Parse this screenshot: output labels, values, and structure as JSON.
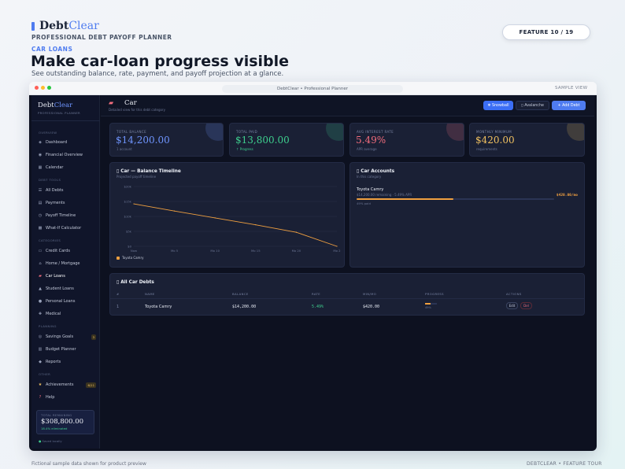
{
  "brand": {
    "name_part1": "Debt",
    "name_part2": "Clear",
    "tagline": "PROFESSIONAL DEBT PAYOFF PLANNER"
  },
  "badge": "FEATURE 10 / 19",
  "eyebrow": "CAR LOANS",
  "headline": "Make car-loan progress visible",
  "subhead": "See outstanding balance, rate, payment, and payoff projection at a glance.",
  "footer": {
    "left": "Fictional sample data shown for product preview",
    "right": "DEBTCLEAR  •  FEATURE TOUR"
  },
  "window": {
    "url": "DebtClear  •  Professional Planner",
    "sample": "SAMPLE VIEW"
  },
  "sidebar": {
    "logo_part1": "Debt",
    "logo_part2": "Clear",
    "subtitle": "PROFESSIONAL PLANNER",
    "sections": {
      "overview": "OVERVIEW",
      "tools": "DEBT TOOLS",
      "categories": "CATEGORIES",
      "planning": "PLANNING",
      "other": "OTHER"
    },
    "items": [
      {
        "label": "Dashboard",
        "icon": "◈"
      },
      {
        "label": "Financial Overview",
        "icon": "◉"
      },
      {
        "label": "Calendar",
        "icon": "▦"
      },
      {
        "label": "All Debts",
        "icon": "☰"
      },
      {
        "label": "Payments",
        "icon": "▤"
      },
      {
        "label": "Payoff Timeline",
        "icon": "◷"
      },
      {
        "label": "What-If Calculator",
        "icon": "▩"
      },
      {
        "label": "Credit Cards",
        "icon": "▭"
      },
      {
        "label": "Home / Mortgage",
        "icon": "⌂"
      },
      {
        "label": "Car Loans",
        "icon": "▰"
      },
      {
        "label": "Student Loans",
        "icon": "▲"
      },
      {
        "label": "Personal Loans",
        "icon": "●"
      },
      {
        "label": "Medical",
        "icon": "✚"
      },
      {
        "label": "Savings Goals",
        "icon": "◎",
        "badge": "3"
      },
      {
        "label": "Budget Planner",
        "icon": "▥"
      },
      {
        "label": "Reports",
        "icon": "◆"
      },
      {
        "label": "Achievements",
        "icon": "★",
        "badge": "6/11"
      },
      {
        "label": "Help",
        "icon": "?"
      }
    ],
    "total_label": "TOTAL REMAINING",
    "total_value": "$308,800.00",
    "total_pct": "18.4% eliminated",
    "saved": "Saved locally"
  },
  "topbar": {
    "title": "Car",
    "subtitle": "Detailed view for this debt category",
    "snowball": "❄ Snowball",
    "avalanche": "▯ Avalanche",
    "add": "+ Add Debt"
  },
  "stats": [
    {
      "label": "TOTAL BALANCE",
      "value": "$14,200.00",
      "sub": "1 account",
      "color": "#6f95ff"
    },
    {
      "label": "TOTAL PAID",
      "value": "$13,800.00",
      "sub": "↑ Progress",
      "color": "#3ecf8e"
    },
    {
      "label": "AVG INTEREST RATE",
      "value": "5.49%",
      "sub": "APR average",
      "color": "#f26d7d"
    },
    {
      "label": "MONTHLY MINIMUM",
      "value": "$420.00",
      "sub": "requirements",
      "color": "#f0c060"
    }
  ],
  "timeline": {
    "title": "▯ Car — Balance Timeline",
    "subtitle": "Projected payoff timeline",
    "legend": "Toyota Camry"
  },
  "chart_data": {
    "type": "line",
    "title": "Car — Balance Timeline",
    "x": [
      "Now",
      "Mo 5",
      "Mo 10",
      "Mo 15",
      "Mo 20",
      "Mo 2"
    ],
    "series": [
      {
        "name": "Toyota Camry",
        "values": [
          14200,
          11800,
          9500,
          7200,
          4700,
          0
        ]
      }
    ],
    "ytick_labels": [
      "$0",
      "$5k",
      "$10k",
      "$15k",
      "$20k"
    ],
    "ylim": [
      0,
      20000
    ],
    "grid": true,
    "legend": "bottom-left",
    "color": "#f0a040"
  },
  "accounts": {
    "title": "▯ Car Accounts",
    "subtitle": "In this category",
    "name": "Toyota Camry",
    "detail": "$14,200.00 remaining · 5.49% APR",
    "amount": "$420.00/mo",
    "progress_label": "49% paid",
    "progress": 0.49
  },
  "table": {
    "title": "▯ All Car Debts",
    "headers": [
      "#",
      "NAME",
      "BALANCE",
      "RATE",
      "MIN/MO",
      "PROGRESS",
      "ACTIONS"
    ],
    "row": {
      "num": "1",
      "name": "Toyota Camry",
      "balance": "$14,200.00",
      "rate": "5.49%",
      "min": "$420.00",
      "progress_text": "49%",
      "progress": 0.49,
      "edit": "Edit",
      "del": "Del"
    }
  }
}
